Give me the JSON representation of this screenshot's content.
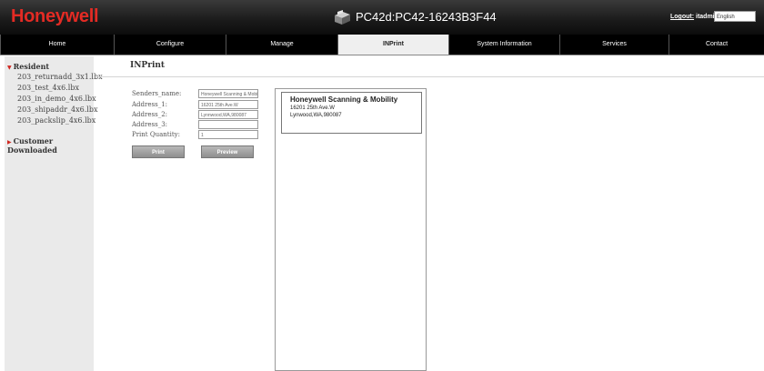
{
  "header": {
    "logo": "Honeywell",
    "device_title": "PC42d:PC42-16243B3F44",
    "logout_label": "Logout:",
    "user": "itadmin",
    "language": "English"
  },
  "nav": {
    "tabs": [
      {
        "label": "Home"
      },
      {
        "label": "Configure"
      },
      {
        "label": "Manage"
      },
      {
        "label": "INPrint",
        "active": true
      },
      {
        "label": "System Information"
      },
      {
        "label": "Services"
      },
      {
        "label": "Contact"
      }
    ]
  },
  "sidebar": {
    "resident_label": "Resident",
    "files": [
      "203_returnadd_3x1.lbx",
      "203_test_4x6.lbx",
      "203_in_demo_4x6.lbx",
      "203_shipaddr_4x6.lbx",
      "203_packslip_4x6.lbx"
    ],
    "customer_label": "Customer Downloaded"
  },
  "main": {
    "title": "INPrint",
    "fields": [
      {
        "label": "Senders_name:",
        "value": "Honeywell Scanning & Mobility"
      },
      {
        "label": "Address_1:",
        "value": "16201 25th Ave.W"
      },
      {
        "label": "Address_2:",
        "value": "Lynnwood,WA,980087"
      },
      {
        "label": "Address_3:",
        "value": ""
      },
      {
        "label": "Print Quantity:",
        "value": "1"
      }
    ],
    "print_button": "Print",
    "preview_button": "Preview"
  },
  "preview": {
    "line1": "Honeywell Scanning & Mobility",
    "line2": "16201 25th Ave.W",
    "line3": "Lynwood,WA,980087"
  },
  "colors": {
    "brand_red": "#e32b24",
    "header_bg": "#1a1a1a",
    "active_tab_bg": "#efefef"
  }
}
